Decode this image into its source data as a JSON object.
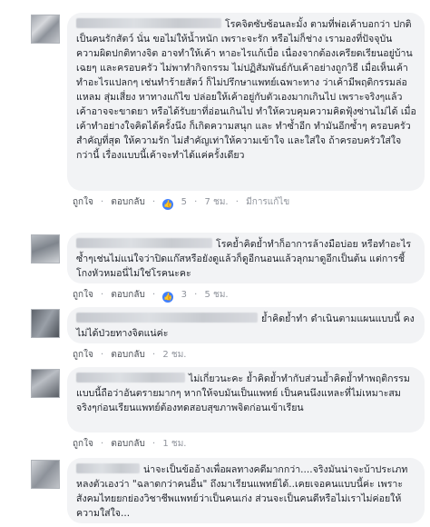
{
  "actions": {
    "like": "ถูกใจ",
    "reply": "ตอบกลับ",
    "sep": "·"
  },
  "comments": [
    {
      "text": "โรคจิตซับซ้อนละมั้ง ตามที่พ่อเค้าบอกว่า ปกติเป็นคนรักสัตว์ นั่น ขอไม่ให้น้ำหนัก เพราะจะรัก หรือไม่ก็ช่าง เรามองที่ปัจจุบัน ความผิดปกติทางจิต อาจทำให้เค้า หาอะไรแก้เบื่อ เนื่องจากต้องเครียดเรียนอยู่บ้านเฉยๆ และครอบครัว ไม่พาทำกิจกรรม ไม่ปฏิสัมพันธ์กับเค้าอย่างถูกวิธี เมื่อเห็นเค้าทำอะไรแปลกๆ เช่นทำร้ายสัตว์ ก็ไม่ปรึกษาแพทย์เฉพาะทาง ว่าเค้ามีพฤติกรรมล่อแหลม สุ่มเสี่ยง หาทางแก้ไข ปล่อยให้เค้าอยู่กับตัวเองมากเกินไป เพราะจริงๆแล้วเค้าอาจจะขาดยา หรือได้รับยาที่อ่อนเกินไป ทำให้ควบคุมความคิดฟุ้งซ่านไม่ได้ เมื่อเค้าทำอย่างใจคิดได้ครั้งนึง ก็เกิดความสนุก และ ทำซ้ำอีก ทำมันอีกซ้ำๆ ครอบครัวสำคัญที่สุด ให้ความรัก ไม่สำคัญเท่าให้ความเข้าใจ และใส่ใจ ถ้าครอบครัวใส่ใจกว่านี้ เรื่องแบบนี้เค้าจะทำได้แค่ครั้งเดียว",
      "likes": "5",
      "time": "7 ชม.",
      "edited": "มีการแก้ไข"
    },
    {
      "text": "โรคย้ำคิดย้ำทำก็อาการล้างมือบ่อย หรือทำอะไรซ้ำๆเช่นไม่แน่ใจว่าปิดแก๊สหรือยังดูแล้วก็ดูอีกนอนแล้วลุกมาดูอีกเป็นต้น แต่การชี้โกงหัวหมอนี่ไม่ใช่โรคนะคะ",
      "likes": "3",
      "time": "5 ชม."
    },
    {
      "text": "ย้ำคิดย้ำทำ ดำเนินตามแผนแบบนี้ คงไม่ได้ป่วยทางจิตแน่ค่ะ",
      "time": "2 ชม."
    },
    {
      "text": "ไม่เกี่ยวนะคะ ย้ำคิดย้ำทำกับส่วนย้ำคิดย้ำทำพฤติกรรมแบบนี้ถือว่าอันตรายมากๆ หากให้จบมันเป็นแพทย์ เป็นคนนึงแหละที่ไม่เหมาะสม จริงๆก่อนเรียนแพทย์ต้องทดสอบสุขภาพจิตก่อนเข้าเรียน",
      "time": "1 ชม."
    },
    {
      "text": "น่าจะเป็นข้ออ้างเพื่อผลทางคดีมากกว่า....จริงมันน่าจะบ้าประเภทหลงตัวเองว่า \"ฉลาดกว่าคนอื่น\" ถึงมาเรียนแพทย์ได้..เคยเจอคนแบบนี้ค่ะ เพราะสังคมไทยยกย่องวิชาชีพแพทย์ว่าเป็นคนเก่ง ส่วนจะเป็นคนดีหรือไม่เราไม่ค่อยให้ความใส่ใจ..."
    }
  ]
}
